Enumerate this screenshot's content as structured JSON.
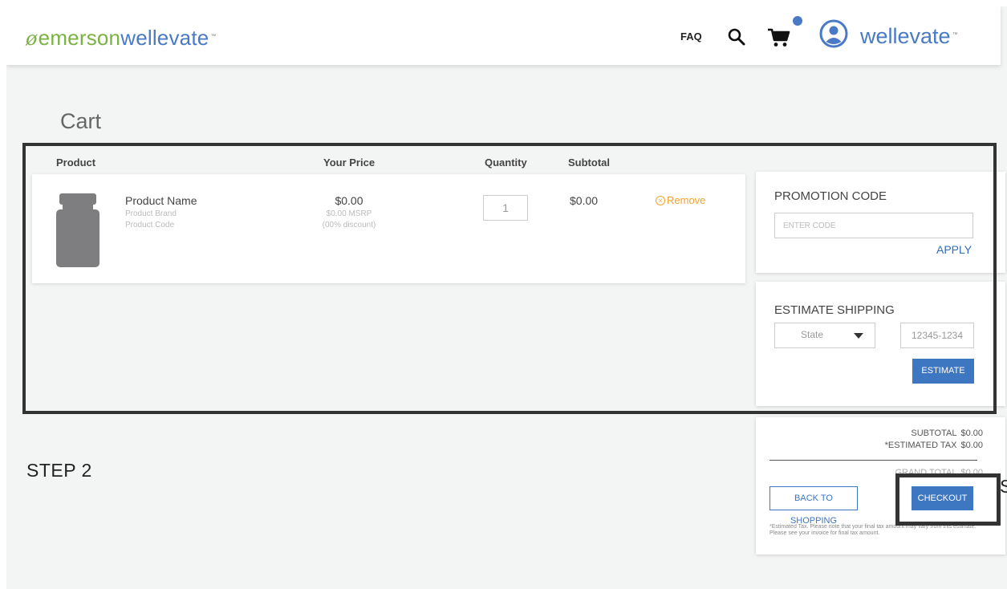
{
  "header": {
    "logo_part1": "emerson",
    "logo_part2": "wellevate",
    "logo_tm": "™",
    "faq_label": "FAQ",
    "brand_label": "wellevate",
    "brand_tm": "™"
  },
  "page_title": "Cart",
  "columns": {
    "product": "Product",
    "your_price": "Your Price",
    "quantity": "Quantity",
    "subtotal": "Subtotal"
  },
  "cart_item": {
    "name": "Product Name",
    "brand": "Product Brand",
    "code": "Product Code",
    "price": "$0.00",
    "msrp": "$0.00 MSRP",
    "discount": "(00% discount)",
    "quantity": "1",
    "subtotal": "$0.00",
    "remove_label": "Remove"
  },
  "promotion": {
    "title": "PROMOTION CODE",
    "placeholder": "ENTER CODE",
    "apply_label": "APPLY"
  },
  "shipping": {
    "title": "ESTIMATE SHIPPING",
    "state_value": "State",
    "zip_placeholder": "12345-1234",
    "estimate_label": "ESTIMATE"
  },
  "summary": {
    "subtotal_label": "SUBTOTAL",
    "subtotal_value": "$0.00",
    "tax_label": "*ESTIMATED TAX",
    "tax_value": "$0.00",
    "grand_label": "GRAND TOTAL",
    "grand_value": "$0.00",
    "back_label": "BACK TO SHOPPING",
    "checkout_label": "CHECKOUT",
    "disclaimer": "*Estimated Tax. Please note that your final tax amount may vary from this estimate. Please see your invoice for final tax amount."
  },
  "annotations": {
    "step_label": "STEP 2",
    "step_label_clipped": "S"
  },
  "colors": {
    "brand_blue": "#4a7ac5",
    "brand_green": "#7bb242",
    "button_blue": "#3d76c1",
    "remove_orange": "#f0a030"
  }
}
